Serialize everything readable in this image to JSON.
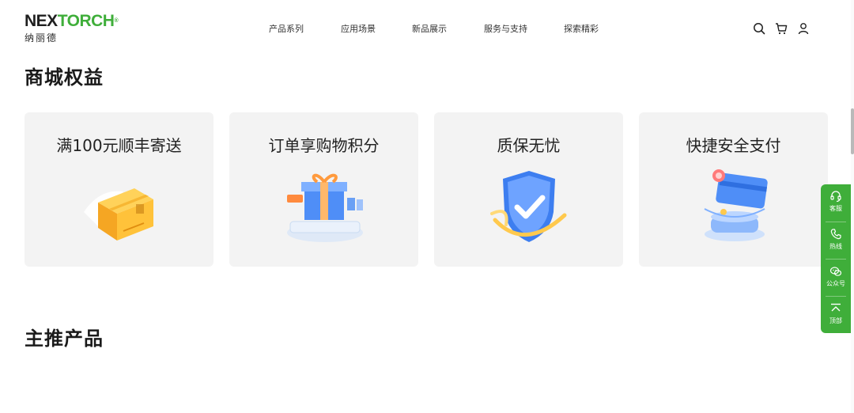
{
  "brand": {
    "logo_part1": "NEX",
    "logo_part2": "TORCH",
    "logo_reg": "®",
    "logo_cn": "纳丽德",
    "accent": "#3fae3a"
  },
  "nav": {
    "items": [
      {
        "label": "产品系列"
      },
      {
        "label": "应用场景"
      },
      {
        "label": "新品展示"
      },
      {
        "label": "服务与支持"
      },
      {
        "label": "探索精彩"
      }
    ]
  },
  "header_icons": [
    "search-icon",
    "cart-icon",
    "user-icon"
  ],
  "benefits_section": {
    "title": "商城权益",
    "cards": [
      {
        "title": "满100元顺丰寄送",
        "icon": "parcel-box-icon"
      },
      {
        "title": "订单享购物积分",
        "icon": "gift-box-icon"
      },
      {
        "title": "质保无忧",
        "icon": "shield-check-icon"
      },
      {
        "title": "快捷安全支付",
        "icon": "payment-card-icon"
      }
    ]
  },
  "featured_section": {
    "title": "主推产品"
  },
  "side_bar": {
    "items": [
      {
        "label": "客服",
        "icon": "customer-service-icon"
      },
      {
        "label": "热线",
        "icon": "phone-icon"
      },
      {
        "label": "公众号",
        "icon": "wechat-icon"
      },
      {
        "label": "顶部",
        "icon": "back-to-top-icon"
      }
    ]
  }
}
